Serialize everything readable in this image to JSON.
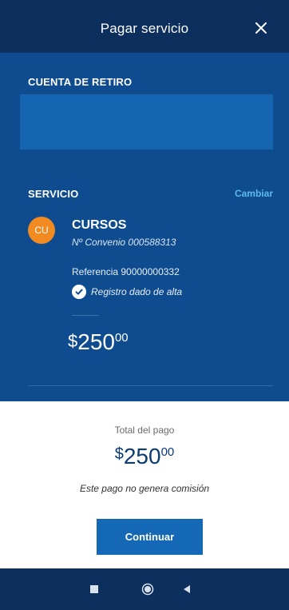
{
  "header": {
    "title": "Pagar servicio"
  },
  "withdrawal": {
    "label": "CUENTA DE RETIRO"
  },
  "service": {
    "label": "SERVICIO",
    "change_label": "Cambiar",
    "avatar_initials": "CU",
    "name": "CURSOS",
    "agreement": "Nº Convenio 000588313",
    "reference": "Referencia 90000000332",
    "status": "Registro dado de alta",
    "amount": {
      "symbol": "$",
      "integer": "250",
      "decimals": "00"
    }
  },
  "total": {
    "label": "Total del pago",
    "amount": {
      "symbol": "$",
      "integer": "250",
      "decimals": "00"
    },
    "commission_note": "Este pago no genera comisión"
  },
  "actions": {
    "continue_label": "Continuar"
  },
  "icons": {
    "close": "close-icon",
    "check": "check-circle-icon",
    "nav": [
      "nav-square-icon",
      "nav-home-icon",
      "nav-back-icon"
    ]
  },
  "colors": {
    "header_bg": "#0c2f5e",
    "panel_bg": "#0f4c8f",
    "account_box": "#1565b0",
    "accent_link": "#5bbcec",
    "avatar": "#f28a22",
    "button": "#1468b6",
    "total_amount": "#0c3a73"
  }
}
